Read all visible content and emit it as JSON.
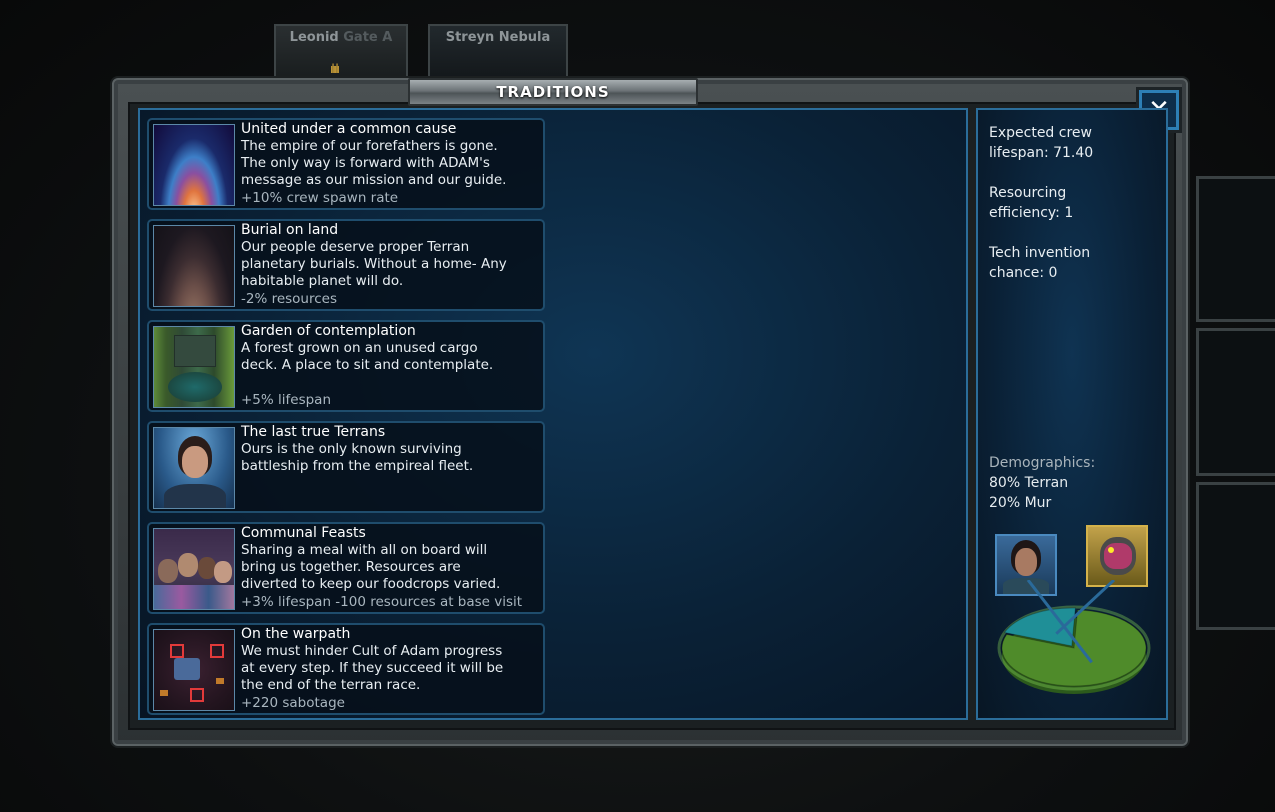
{
  "background": {
    "tabs": [
      {
        "name_bold": "Leonid",
        "name_dim": "Gate A"
      },
      {
        "name": "Streyn Nebula"
      }
    ]
  },
  "window": {
    "title": "TRADITIONS",
    "close_icon": "close-icon"
  },
  "traditions": [
    {
      "title": "United under a common cause",
      "description": "The empire of our forefathers is gone.\nThe only way is forward with ADAM's\nmessage as our mission and our guide.",
      "bonus": "+10% crew spawn rate",
      "icon": "planet-sunrise-image"
    },
    {
      "title": "Burial on land",
      "description": "Our people deserve proper Terran\nplanetary burials. Without a home- Any\nhabitable planet will do.",
      "bonus": "-2% resources",
      "icon": "dusty-planet-image"
    },
    {
      "title": "Garden of contemplation",
      "description": "A forest grown on an unused cargo\ndeck. A place to sit and contemplate.",
      "bonus": "+5% lifespan",
      "icon": "garden-deck-image"
    },
    {
      "title": "The last true Terrans",
      "description": "Ours is the only known surviving\nbattleship from the empireal fleet.",
      "bonus": "",
      "icon": "terran-officer-portrait"
    },
    {
      "title": "Communal Feasts",
      "description": "Sharing a meal with all on board will\nbring us together. Resources are\ndiverted to keep our foodcrops varied.",
      "bonus": "+3% lifespan -100 resources at base visit",
      "icon": "crew-group-image"
    },
    {
      "title": "On the warpath",
      "description": "We must hinder Cult of Adam progress\nat every step. If they succeed it will be\nthe end of the terran race.",
      "bonus": "+220 sabotage",
      "icon": "warpath-map-image"
    }
  ],
  "stats": {
    "lifespan": "Expected crew\nlifespan: 71.40",
    "resourcing": "Resourcing\nefficiency: 1",
    "tech": "Tech invention\nchance: 0"
  },
  "demographics": {
    "label": "Demographics:",
    "rows": [
      "80% Terran",
      "20% Mur"
    ]
  },
  "chart_data": {
    "type": "pie",
    "categories": [
      "Terran",
      "Mur"
    ],
    "values": [
      80,
      20
    ],
    "colors": [
      "#4f8b2a",
      "#1f8f97"
    ]
  }
}
